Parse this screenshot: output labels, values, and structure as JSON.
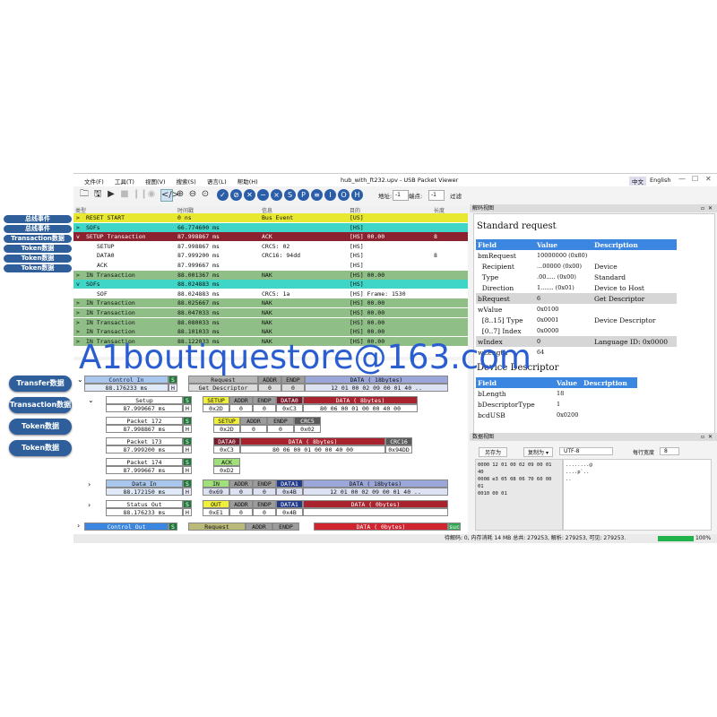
{
  "app": {
    "title": "hub_with_ft232.upv - USB Packet Viewer",
    "menu": [
      "文件(F)",
      "工具(T)",
      "视图(V)",
      "搜索(S)",
      "语言(L)",
      "帮助(H)"
    ],
    "lang_buttons": [
      "中文",
      "English"
    ],
    "toolbar": {
      "address_label": "地址:",
      "address_value": "-1",
      "endpoint_label": "端点:",
      "endpoint_value": "-1",
      "filter_label": "过滤"
    }
  },
  "side_labels": {
    "small": [
      "总线事件",
      "总线事件",
      "Transaction数据",
      "Token数据",
      "Token数据",
      "Token数据"
    ],
    "large": [
      "Transfer数据",
      "Transaction数据",
      "Token数据",
      "Token数据"
    ]
  },
  "event_list": {
    "columns": [
      "类型",
      "时间戳",
      "信息",
      "目的",
      "长度"
    ],
    "rows": [
      {
        "expander": ">",
        "type": "RESET START",
        "time": "0 ns",
        "info": "Bus Event",
        "dest": "[US]",
        "len": "",
        "color": "#e8e830"
      },
      {
        "expander": ">",
        "type": "SOFs",
        "time": "66.774600 ms",
        "info": "",
        "dest": "[HS]",
        "len": "",
        "color": "#3fd6c7"
      },
      {
        "expander": "v",
        "type": "SETUP Transaction",
        "time": "87.998867 ms",
        "info": "ACK",
        "dest": "[HS] 00.00",
        "len": "8",
        "color": "#8a2230"
      },
      {
        "expander": "",
        "type": "SETUP",
        "time": "87.998867 ms",
        "info": "CRC5: 02",
        "dest": "[HS]",
        "len": "",
        "color": "#ffffff"
      },
      {
        "expander": "",
        "type": "DATA0",
        "time": "87.999200 ms",
        "info": "CRC16: 94dd",
        "dest": "[HS]",
        "len": "8",
        "color": "#ffffff"
      },
      {
        "expander": "",
        "type": "ACK",
        "time": "87.999667 ms",
        "info": "",
        "dest": "[HS]",
        "len": "",
        "color": "#ffffff"
      },
      {
        "expander": ">",
        "type": "IN Transaction",
        "time": "88.001367 ms",
        "info": "NAK",
        "dest": "[HS] 00.00",
        "len": "",
        "color": "#8fbe86"
      },
      {
        "expander": "v",
        "type": "SOFs",
        "time": "88.024883 ms",
        "info": "",
        "dest": "[HS]",
        "len": "",
        "color": "#3fd6c7"
      },
      {
        "expander": "",
        "type": "SOF",
        "time": "88.024883 ms",
        "info": "CRC5: 1a",
        "dest": "[HS] Frame: 1530",
        "len": "",
        "color": "#ffffff"
      },
      {
        "expander": ">",
        "type": "IN Transaction",
        "time": "88.025667 ms",
        "info": "NAK",
        "dest": "[HS] 00.00",
        "len": "",
        "color": "#8fbe86"
      },
      {
        "expander": ">",
        "type": "IN Transaction",
        "time": "88.047033 ms",
        "info": "NAK",
        "dest": "[HS] 00.00",
        "len": "",
        "color": "#8fbe86"
      },
      {
        "expander": ">",
        "type": "IN Transaction",
        "time": "88.080033 ms",
        "info": "NAK",
        "dest": "[HS] 00.00",
        "len": "",
        "color": "#8fbe86"
      },
      {
        "expander": ">",
        "type": "IN Transaction",
        "time": "88.101033 ms",
        "info": "NAK",
        "dest": "[HS] 00.00",
        "len": "",
        "color": "#8fbe86"
      },
      {
        "expander": ">",
        "type": "IN Transaction",
        "time": "88.122033 ms",
        "info": "NAK",
        "dest": "[HS] 00.00",
        "len": "",
        "color": "#8fbe86"
      }
    ]
  },
  "transfer": {
    "control_in": {
      "label": "Control In",
      "time": "88.176233 ms",
      "s": "S",
      "h": "H",
      "request": "Request",
      "request_val": "Get Descriptor",
      "addr": "ADDR",
      "addr_val": "0",
      "endp": "ENDP",
      "endp_val": "0",
      "data": "DATA ( 18bytes)",
      "data_val": "12 01 00 02 09 00 01 40 .."
    },
    "setup": {
      "label": "Setup",
      "time": "87.999667 ms",
      "s": "S",
      "h": "H",
      "pid": "SETUP",
      "pid_val": "0x2D",
      "addr": "ADDR",
      "addr_val": "0",
      "endp": "ENDP",
      "endp_val": "0",
      "data0": "DATA0",
      "data0_val": "0xC3",
      "data": "DATA ( 8bytes)",
      "data_val": "80 06 00 01 00 00 40 00"
    },
    "packet172": {
      "label": "Packet 172",
      "time": "87.998867 ms",
      "s": "S",
      "h": "H",
      "pid": "SETUP",
      "pid_val": "0x2D",
      "addr": "ADDR",
      "addr_val": "0",
      "endp": "ENDP",
      "endp_val": "0",
      "crc": "CRC5",
      "crc_val": "0x02"
    },
    "packet173": {
      "label": "Packet 173",
      "time": "87.999200 ms",
      "s": "S",
      "h": "H",
      "pid": "DATA0",
      "pid_val": "0xC3",
      "data": "DATA ( 8bytes)",
      "data_val": "80 06 00 01 00 00 40 00",
      "crc": "CRC16",
      "crc_val": "0x94DD"
    },
    "packet174": {
      "label": "Packet 174",
      "time": "87.999667 ms",
      "s": "S",
      "h": "H",
      "pid": "ACK",
      "pid_val": "0xD2"
    },
    "data_in": {
      "label": "Data In",
      "time": "88.172150 ms",
      "s": "S",
      "h": "H",
      "pid": "IN",
      "pid_val": "0x69",
      "addr": "ADDR",
      "addr_val": "0",
      "endp": "ENDP",
      "endp_val": "0",
      "data1": "DATA1",
      "data1_val": "0x4B",
      "data": "DATA ( 18bytes)",
      "data_val": "12 01 00 02 09 00 01 40 .."
    },
    "status_out": {
      "label": "Status Out",
      "time": "88.176233 ms",
      "s": "S",
      "h": "H",
      "pid": "OUT",
      "pid_val": "0xE1",
      "addr": "ADDR",
      "addr_val": "0",
      "endp": "ENDP",
      "endp_val": "0",
      "data1": "DATA1",
      "data1_val": "0x4B",
      "data": "DATA ( 0bytes)"
    },
    "control_out": {
      "label": "Control Out",
      "s": "S",
      "request": "Request",
      "addr": "ADDR",
      "endp": "ENDP",
      "data": "DATA ( 0bytes)",
      "suc": "suc"
    }
  },
  "decode_view": {
    "pane_title": "解码视图",
    "heading": "Standard request",
    "columns": [
      "Field",
      "Value",
      "Description"
    ],
    "rows": [
      {
        "field": "bmRequest",
        "value": "10000000 (0x80)",
        "desc": ""
      },
      {
        "field": "  Recipient",
        "value": "...00000 (0x00)",
        "desc": "Device"
      },
      {
        "field": "  Type",
        "value": ".00..... (0x00)",
        "desc": "Standard"
      },
      {
        "field": "  Direction",
        "value": "1....... (0x01)",
        "desc": "Device to Host"
      },
      {
        "field": "bRequest",
        "value": "6",
        "desc": "Get Descriptor"
      },
      {
        "field": "wValue",
        "value": "0x0100",
        "desc": ""
      },
      {
        "field": "  [8..15] Type",
        "value": "0x0001",
        "desc": "Device Descriptor"
      },
      {
        "field": "  [0..7] Index",
        "value": "0x0000",
        "desc": ""
      },
      {
        "field": "wIndex",
        "value": "0",
        "desc": "Language ID: 0x0000"
      },
      {
        "field": "wLength",
        "value": "64",
        "desc": ""
      }
    ],
    "heading2": "Device Descriptor",
    "columns2": [
      "Field",
      "Value",
      "Description"
    ],
    "rows2": [
      {
        "field": "bLength",
        "value": "18",
        "desc": ""
      },
      {
        "field": "bDescriptorType",
        "value": "1",
        "desc": ""
      },
      {
        "field": "bcdUSB",
        "value": "0x0200",
        "desc": ""
      }
    ]
  },
  "data_view": {
    "pane_title": "数据视图",
    "save_btn": "另存为",
    "copy_btn": "复制为",
    "encoding": "UTF-8",
    "width_label": "每行宽度",
    "width_value": "8",
    "hex_rows": [
      {
        "offset": "0000",
        "hex": "12 01 00 02 09 00 01 40",
        "ascii": "........@"
      },
      {
        "offset": "0008",
        "hex": "e3 05 08 06 70 60 00 01",
        "ascii": "....p`.."
      },
      {
        "offset": "0010",
        "hex": "00 01",
        "ascii": ".."
      }
    ]
  },
  "status": {
    "text": "待解码: 0,  内存消耗 14 MB  总共: 279253,   解析: 279253,   可见: 279253.",
    "progress_percent": 100,
    "progress_label": "100%"
  },
  "watermark": "A1boutiquestore@163.com"
}
